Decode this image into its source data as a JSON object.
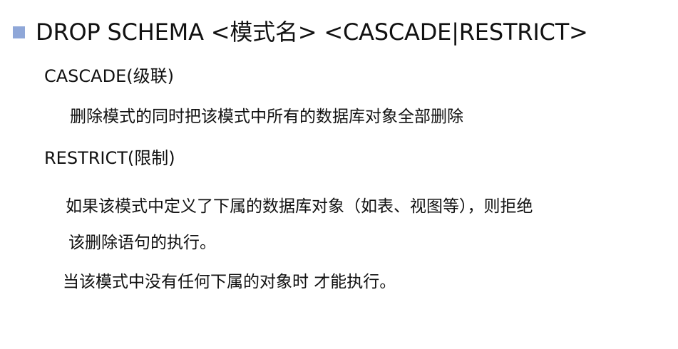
{
  "slide": {
    "heading": "DROP SCHEMA <模式名> <CASCADE|RESTRICT>",
    "bullet_color": "#8fa7d8",
    "cascade": {
      "name": "CASCADE(级联)",
      "description": "删除模式的同时把该模式中所有的数据库对象全部删除"
    },
    "restrict": {
      "name": "RESTRICT(限制)",
      "description_line1": "如果该模式中定义了下属的数据库对象（如表、视图等），则拒绝",
      "description_line2": "该删除语句的执行。",
      "note": "当该模式中没有任何下属的对象时 才能执行。"
    }
  }
}
